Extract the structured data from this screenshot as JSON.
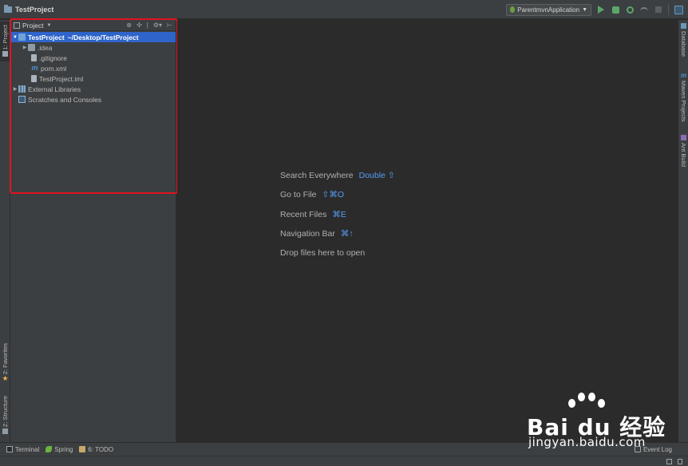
{
  "navbar": {
    "project_name": "TestProject",
    "run_config": "ParentmvnApplication"
  },
  "left_strip": {
    "project_tab": "1: Project",
    "favorites_tab": "2: Favorites",
    "structure_tab": "Z: Structure"
  },
  "right_strip": {
    "database_tab": "Database",
    "maven_tab": "Maven Projects",
    "ant_tab": "Ant Build"
  },
  "project_panel": {
    "title": "Project",
    "tree": [
      {
        "label": "TestProject",
        "path": "~/Desktop/TestProject",
        "icon": "folder-icon"
      },
      {
        "label": ".idea",
        "icon": "folder-icon"
      },
      {
        "label": ".gitignore",
        "icon": "file-icon"
      },
      {
        "label": "pom.xml",
        "icon": "maven-icon"
      },
      {
        "label": "TestProject.iml",
        "icon": "module-file-icon"
      },
      {
        "label": "External Libraries",
        "icon": "library-icon"
      },
      {
        "label": "Scratches and Consoles",
        "icon": "scratch-icon"
      }
    ]
  },
  "editor": {
    "hints": [
      {
        "label": "Search Everywhere",
        "key": "Double ⇧"
      },
      {
        "label": "Go to File",
        "key": "⇧⌘O"
      },
      {
        "label": "Recent Files",
        "key": "⌘E"
      },
      {
        "label": "Navigation Bar",
        "key": "⌘↑"
      },
      {
        "label": "Drop files here to open",
        "key": ""
      }
    ]
  },
  "bottom_bar": {
    "terminal": "Terminal",
    "spring": "Spring",
    "todo": "6: TODO",
    "event_log": "Event Log"
  },
  "watermark": {
    "brand": "Bai du 经验",
    "url": "jingyan.baidu.com"
  },
  "colors": {
    "selection": "#2f65ca",
    "highlight_box": "#e0141f",
    "shortcut": "#589df6"
  }
}
